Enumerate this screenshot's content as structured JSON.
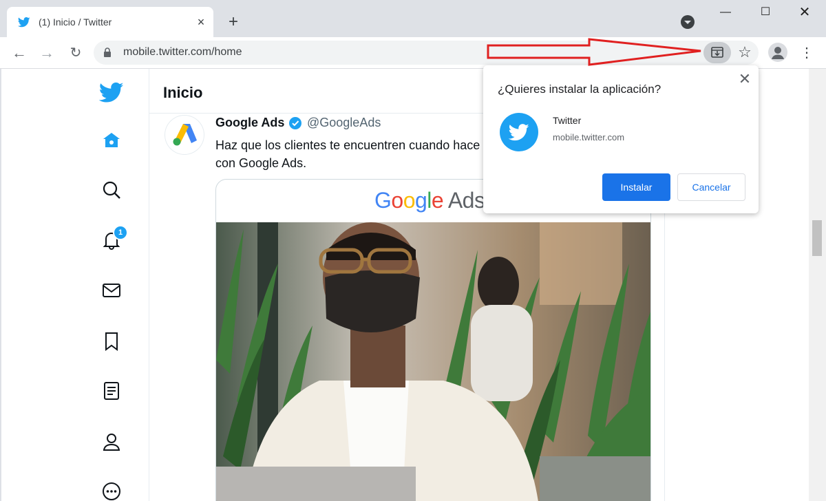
{
  "browser": {
    "tab": {
      "title": "(1) Inicio / Twitter",
      "close_label": "×"
    },
    "new_tab_label": "+",
    "window_controls": {
      "minimize": "—",
      "maximize": "☐",
      "close": "✕"
    },
    "nav": {
      "back": "←",
      "forward": "→",
      "reload": "↻"
    },
    "url": "mobile.twitter.com/home",
    "star_glyph": "☆",
    "menu_glyph": "⋮"
  },
  "sidebar": {
    "items": [
      {
        "icon": "twitter-logo-icon"
      },
      {
        "icon": "home-icon"
      },
      {
        "icon": "search-icon"
      },
      {
        "icon": "notifications-icon",
        "badge": "1"
      },
      {
        "icon": "messages-icon"
      },
      {
        "icon": "bookmarks-icon"
      },
      {
        "icon": "lists-icon"
      },
      {
        "icon": "profile-icon"
      },
      {
        "icon": "more-icon"
      }
    ]
  },
  "header": {
    "title": "Inicio"
  },
  "tweet": {
    "name": "Google Ads",
    "handle": "@GoogleAds",
    "text": "Haz que los clientes te encuentren cuando hace con Google Ads.",
    "card_logo": {
      "google": "Google",
      "ads": "Ads"
    }
  },
  "install_popup": {
    "title": "¿Quieres instalar la aplicación?",
    "close_label": "✕",
    "app_name": "Twitter",
    "app_url": "mobile.twitter.com",
    "install_label": "Instalar",
    "cancel_label": "Cancelar"
  },
  "colors": {
    "twitter_blue": "#1da1f2",
    "chrome_blue": "#1a73e8",
    "annotation_red": "#e02020"
  }
}
